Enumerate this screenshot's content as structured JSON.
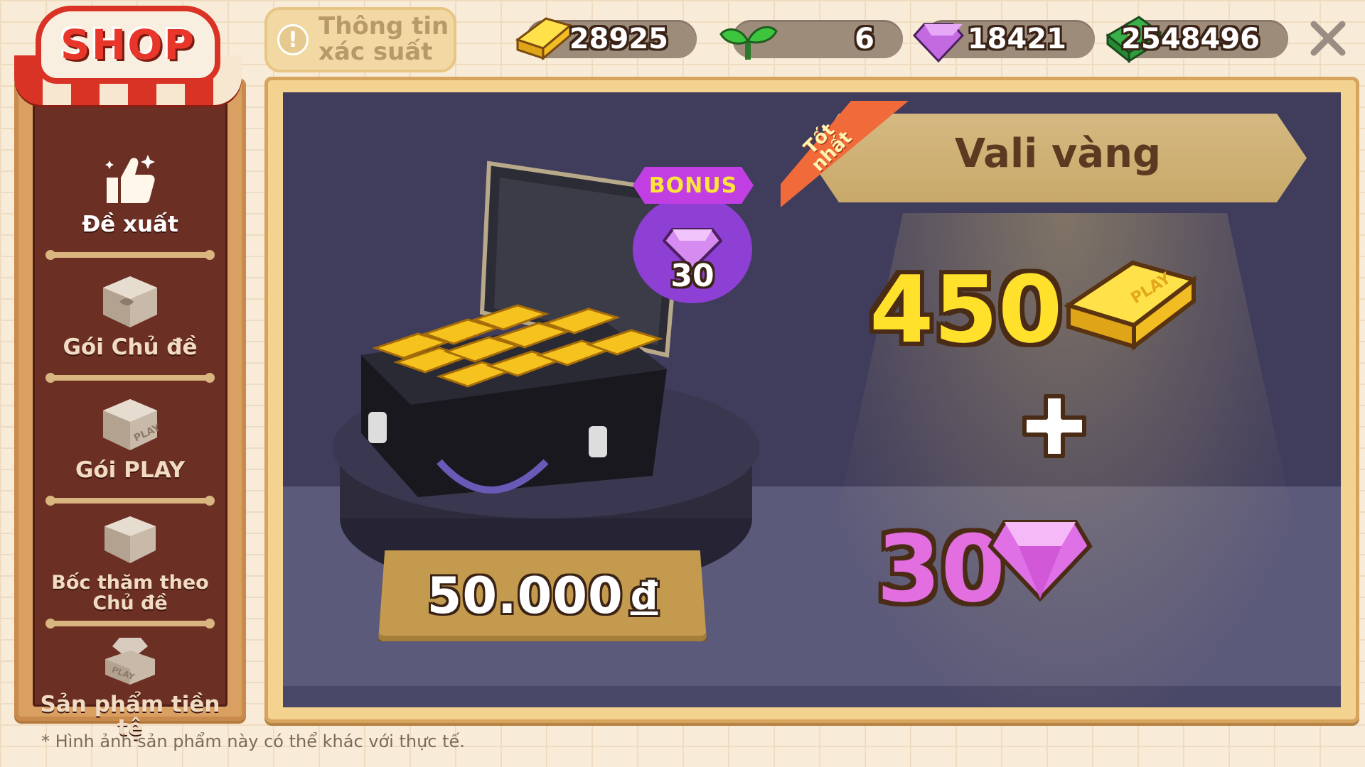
{
  "sidebar": {
    "shop_sign": "SHOP",
    "items": [
      {
        "label": "Đề xuất",
        "icon": "thumbs-up-icon",
        "active": true
      },
      {
        "label": "Gói Chủ đề",
        "icon": "theme-package-icon",
        "active": false
      },
      {
        "label": "Gói PLAY",
        "icon": "play-package-icon",
        "active": false
      },
      {
        "label": "Bốc thăm theo Chủ đề",
        "icon": "gacha-box-icon",
        "active": false
      },
      {
        "label": "Sản phẩm tiền tệ",
        "icon": "currency-products-icon",
        "active": false
      }
    ]
  },
  "topbar": {
    "info_button": {
      "line1": "Thông tin",
      "line2": "xác suất",
      "icon": "exclamation-icon"
    },
    "currencies": [
      {
        "name": "gold",
        "value": "28925",
        "icon": "gold-bar-icon"
      },
      {
        "name": "sprout",
        "value": "6",
        "icon": "sprout-icon"
      },
      {
        "name": "gem",
        "value": "18421",
        "icon": "gem-icon"
      },
      {
        "name": "cash",
        "value": "2548496",
        "icon": "cash-icon"
      }
    ],
    "close_icon": "close-icon"
  },
  "product": {
    "title": "Vali vàng",
    "best_ribbon_line1": "Tốt",
    "best_ribbon_line2": "nhất",
    "bonus_label": "BONUS",
    "bonus_amount": "30",
    "price_amount": "50.000",
    "price_currency": "đ",
    "reward_gold": "450",
    "reward_gem": "30",
    "plus": "+"
  },
  "footnote": "* Hình ảnh sản phẩm này có thể khác với thực tế.",
  "colors": {
    "background": "#f8ecd8",
    "sidebar_frame": "#d9a062",
    "sidebar_inner": "#6b2f24",
    "panel": "#3f3c5c",
    "gold_text": "#ffe12b",
    "gem_text": "#e26ee0",
    "bonus_purple": "#8e3fd4",
    "ribbon_orange": "#f16a3a"
  }
}
